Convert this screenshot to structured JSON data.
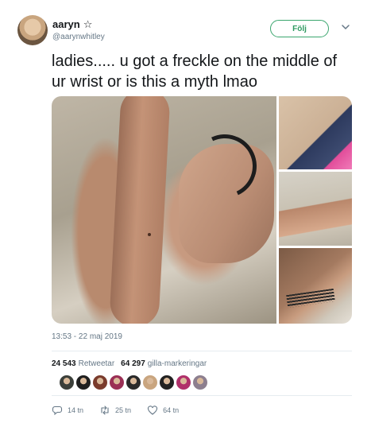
{
  "user": {
    "display_name": "aaryn",
    "name_symbol": "☆",
    "handle": "@aarynwhitley"
  },
  "follow_button": {
    "label": "Följ"
  },
  "tweet": {
    "text": "ladies..... u got a freckle on the middle of ur wrist or is this a myth lmao",
    "timestamp": "13:53 - 22 maj 2019"
  },
  "stats": {
    "retweets_count": "24 543",
    "retweets_label": "Retweetar",
    "likes_count": "64 297",
    "likes_label": "gilla-markeringar"
  },
  "likers": [
    {
      "color": "#3b3f3a"
    },
    {
      "color": "#1f1f1f"
    },
    {
      "color": "#7a3b2c"
    },
    {
      "color": "#9a2f55"
    },
    {
      "color": "#2a2a2a"
    },
    {
      "color": "#c9a57f"
    },
    {
      "color": "#222222"
    },
    {
      "color": "#b0306a"
    },
    {
      "color": "#8d7f8f"
    }
  ],
  "actions": {
    "reply_count": "14 tn",
    "retweet_count": "25 tn",
    "like_count": "64 tn"
  },
  "colors": {
    "follow_accent": "#3aa66e",
    "secondary_text": "#657786"
  },
  "icons": [
    "star-icon",
    "chevron-down-icon",
    "reply-icon",
    "retweet-icon",
    "heart-icon"
  ]
}
